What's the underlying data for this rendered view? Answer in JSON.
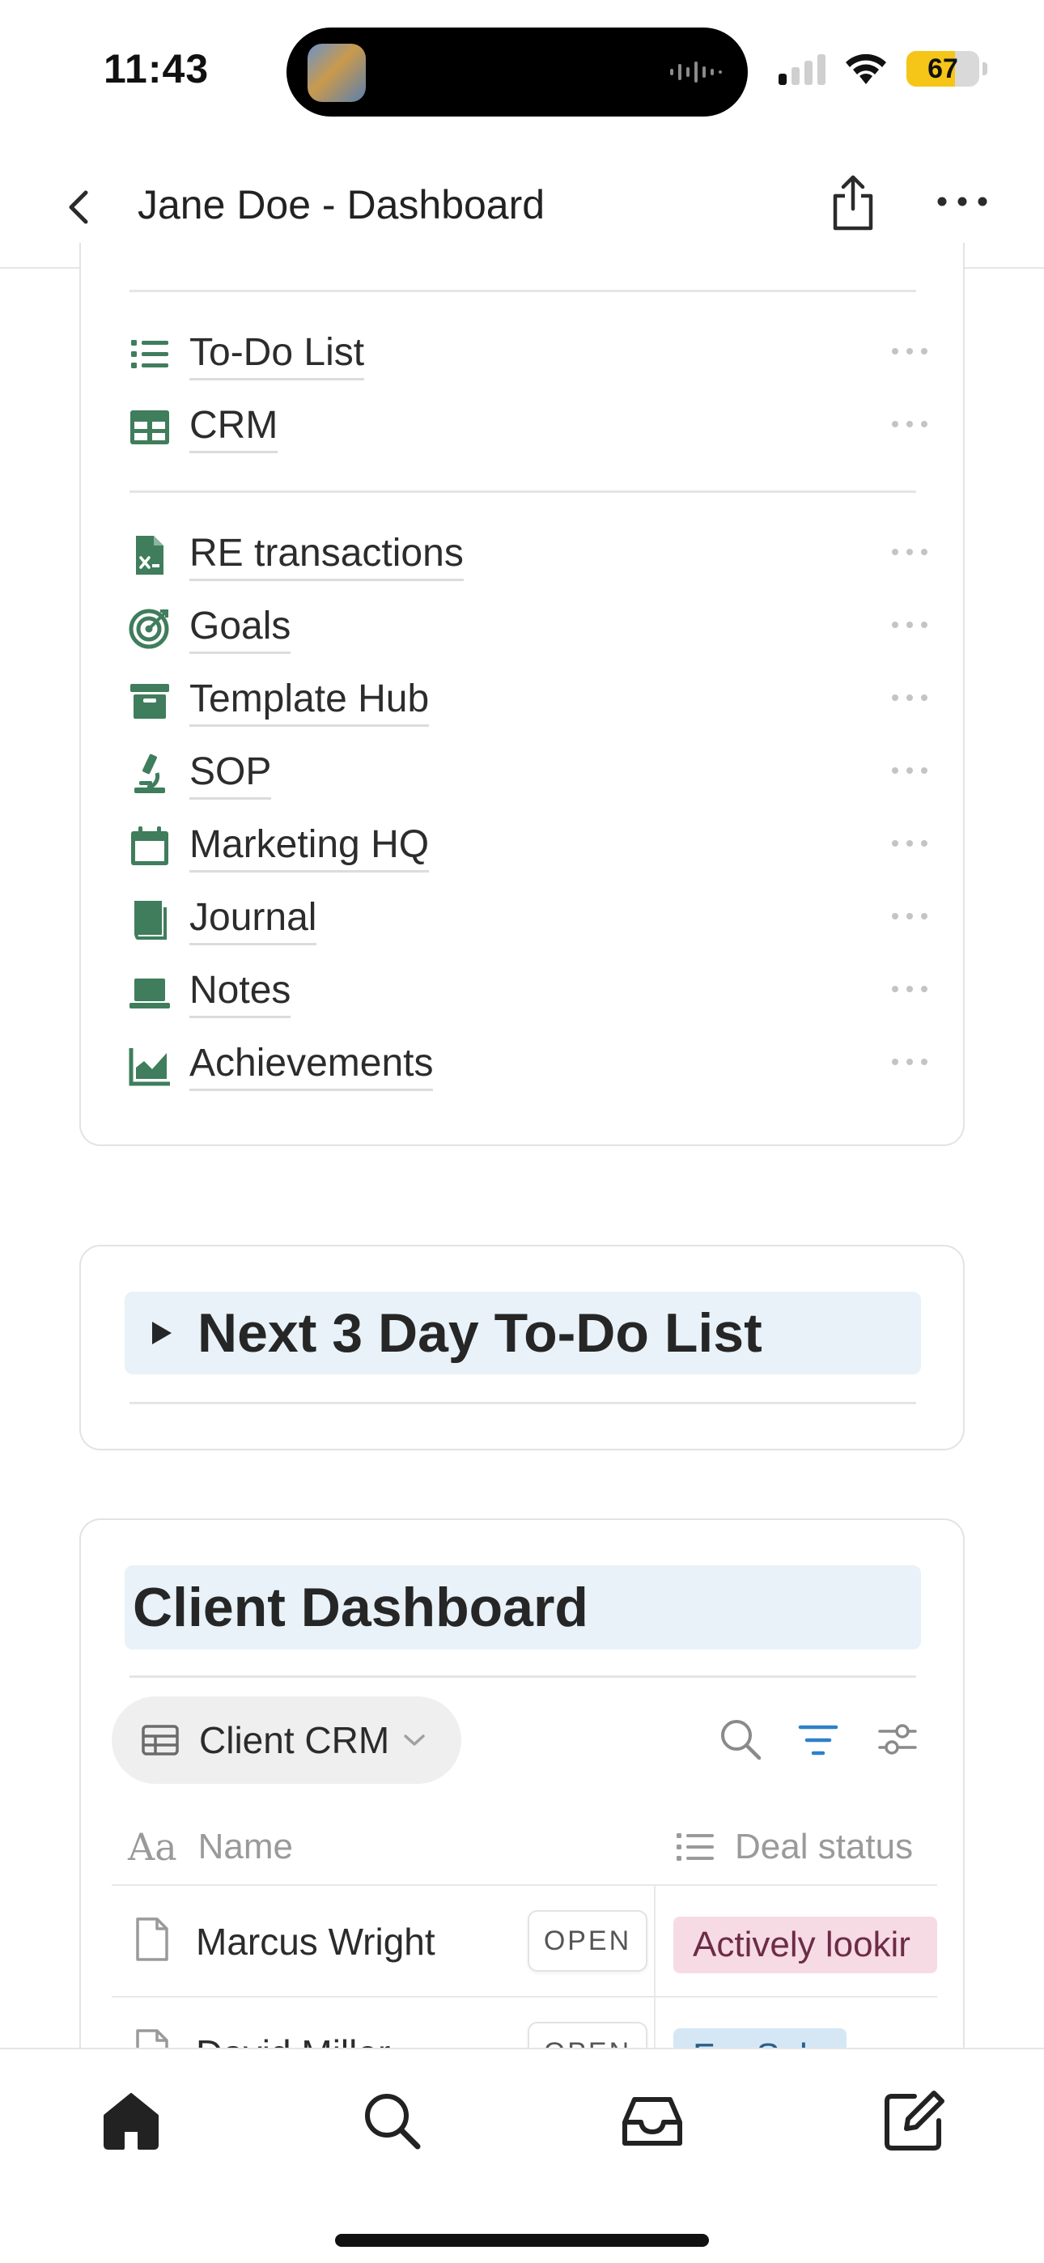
{
  "status_bar": {
    "time": "11:43",
    "battery_level": "67",
    "battery_fraction": 0.67
  },
  "nav": {
    "title": "Jane Doe - Dashboard"
  },
  "page_links": {
    "group_one": [
      {
        "label": "To-Do List",
        "icon": "bullet-list-icon"
      },
      {
        "label": "CRM",
        "icon": "table-icon"
      }
    ],
    "group_two": [
      {
        "label": "RE transactions",
        "icon": "spreadsheet-file-icon"
      },
      {
        "label": "Goals",
        "icon": "target-icon"
      },
      {
        "label": "Template Hub",
        "icon": "archive-box-icon"
      },
      {
        "label": "SOP",
        "icon": "microscope-icon"
      },
      {
        "label": "Marketing HQ",
        "icon": "calendar-icon"
      },
      {
        "label": "Journal",
        "icon": "book-icon"
      },
      {
        "label": "Notes",
        "icon": "laptop-icon"
      },
      {
        "label": "Achievements",
        "icon": "area-chart-icon"
      }
    ]
  },
  "toggle_block": {
    "title": "Next 3 Day To-Do List"
  },
  "client_dashboard": {
    "title": "Client Dashboard",
    "view": {
      "label": "Client CRM"
    },
    "columns": [
      {
        "icon": "text-type-icon",
        "icon_text": "Aa",
        "label": "Name"
      },
      {
        "icon": "list-icon",
        "label": "Deal status"
      }
    ],
    "rows": [
      {
        "name": "Marcus Wright",
        "open_label": "OPEN",
        "status": "Actively lookir",
        "status_color": "pink"
      },
      {
        "name": "David Miller",
        "open_label": "OPEN",
        "status": "For Sale",
        "status_color": "blue"
      }
    ]
  },
  "colors": {
    "icon_green": "#3f7d5c",
    "highlight_blue": "#e8f2f8",
    "accent_blue": "#2f80c9",
    "tag_pink": "#f7dbe4",
    "tag_blue": "#d5e7f5",
    "battery_yellow": "#f5c518"
  }
}
